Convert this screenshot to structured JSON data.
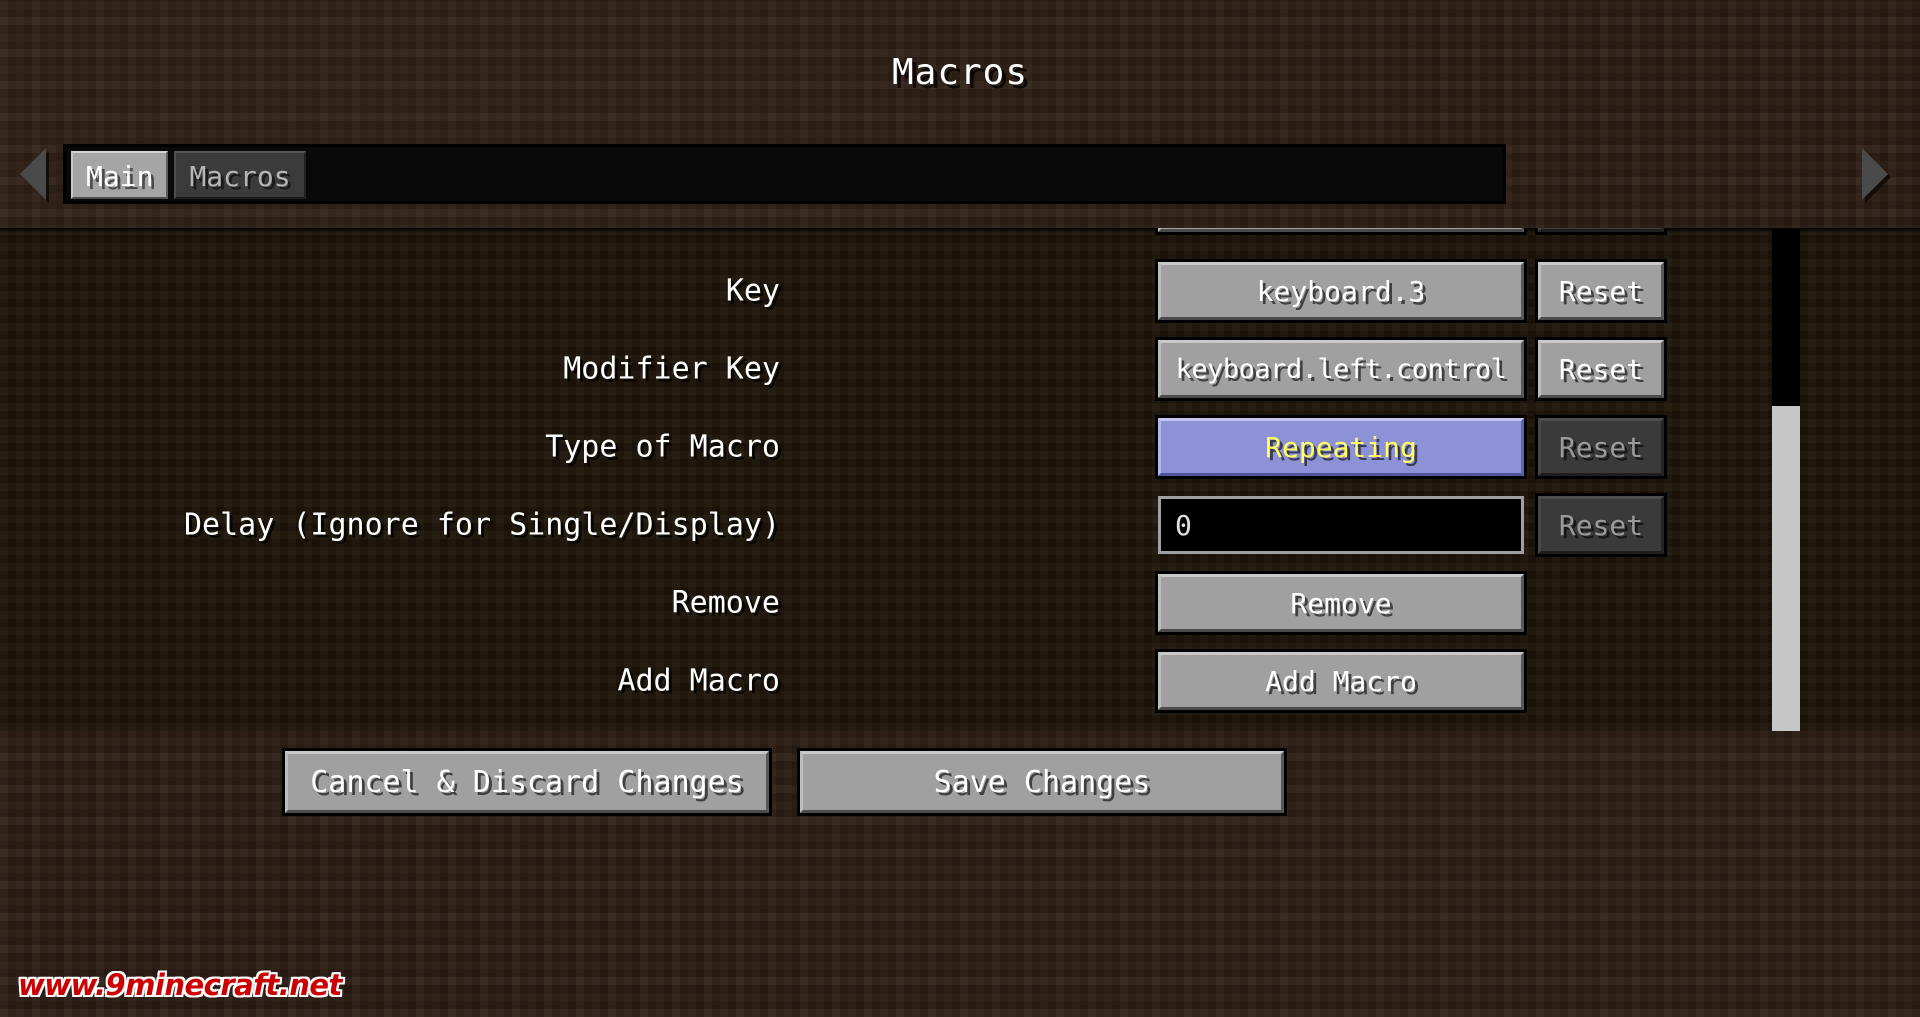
{
  "window": {
    "title": "Macros"
  },
  "tabs": {
    "left_arrow_icon": "chevron-left-icon",
    "right_arrow_icon": "chevron-right-icon",
    "items": [
      {
        "label": "Main",
        "active": true
      },
      {
        "label": "Macros",
        "active": false
      }
    ]
  },
  "settings_list": {
    "rows": [
      {
        "label": "Key",
        "control": {
          "kind": "button",
          "value": "keyboard.3",
          "state": "normal"
        },
        "reset": {
          "label": "Reset",
          "state": "normal"
        }
      },
      {
        "label": "Modifier Key",
        "control": {
          "kind": "button",
          "value": "keyboard.left.control",
          "state": "normal"
        },
        "reset": {
          "label": "Reset",
          "state": "normal"
        }
      },
      {
        "label": "Type of Macro",
        "control": {
          "kind": "button",
          "value": "Repeating",
          "state": "hovered"
        },
        "reset": {
          "label": "Reset",
          "state": "disabled"
        }
      },
      {
        "label": "Delay (Ignore for Single/Display)",
        "control": {
          "kind": "textfield",
          "value": "0",
          "state": "normal"
        },
        "reset": {
          "label": "Reset",
          "state": "disabled"
        }
      },
      {
        "label": "Remove",
        "control": {
          "kind": "button",
          "value": "Remove",
          "state": "normal"
        },
        "reset": null
      },
      {
        "label": "Add Macro",
        "control": {
          "kind": "button",
          "value": "Add Macro",
          "state": "normal"
        },
        "reset": null
      }
    ],
    "scrollbar": {
      "position": "right"
    }
  },
  "footer": {
    "cancel_label": "Cancel & Discard Changes",
    "save_label": "Save Changes"
  },
  "watermark": {
    "text": "www.9minecraft.net",
    "color": "#cc0000"
  },
  "colors": {
    "background": "#2b1d14",
    "list_background": "#1d1408",
    "button_face": "#a0a0a0",
    "button_hovered": "#8d91d6",
    "button_hovered_text": "#ffff62",
    "button_disabled": "#3a3a3a",
    "tab_active": "#a5a5a5",
    "tab_inactive": "#3b3b3b",
    "text": "#ffffff",
    "scrollbar_thumb": "#c6c6c6"
  }
}
